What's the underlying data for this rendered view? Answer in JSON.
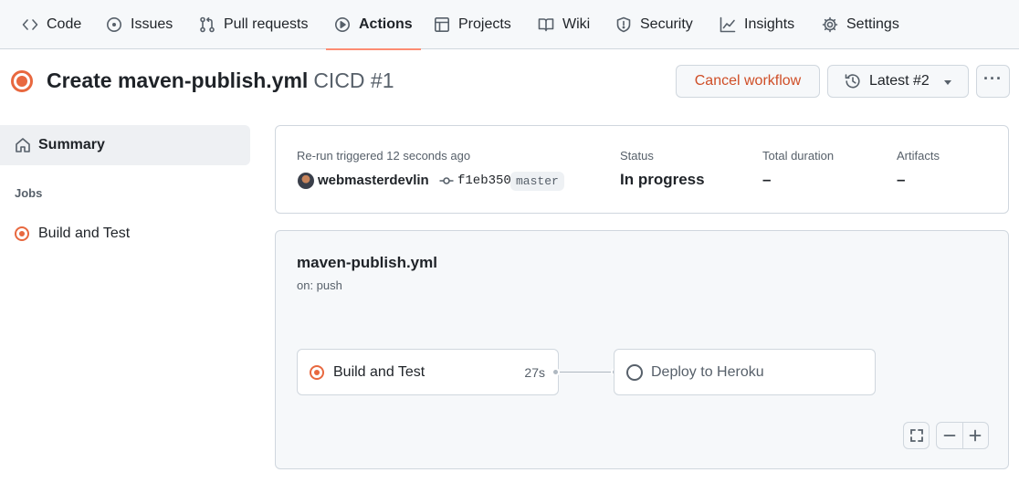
{
  "nav": {
    "items": [
      {
        "label": "Code",
        "icon": "code-icon"
      },
      {
        "label": "Issues",
        "icon": "issue-icon"
      },
      {
        "label": "Pull requests",
        "icon": "pull-request-icon"
      },
      {
        "label": "Actions",
        "icon": "play-icon",
        "active": true
      },
      {
        "label": "Projects",
        "icon": "table-icon"
      },
      {
        "label": "Wiki",
        "icon": "book-icon"
      },
      {
        "label": "Security",
        "icon": "shield-icon"
      },
      {
        "label": "Insights",
        "icon": "graph-icon"
      },
      {
        "label": "Settings",
        "icon": "gear-icon"
      }
    ]
  },
  "header": {
    "title": "Create maven-publish.yml",
    "subtitle": "CICD #1",
    "cancel_label": "Cancel workflow",
    "latest_label": "Latest #2",
    "more_label": "···",
    "status_color": "#e8683f"
  },
  "sidebar": {
    "summary_label": "Summary",
    "jobs_heading": "Jobs",
    "jobs": [
      {
        "label": "Build and Test",
        "status": "in_progress"
      }
    ]
  },
  "run_info": {
    "trigger_text": "Re-run triggered 12 seconds ago",
    "actor": "webmasterdevlin",
    "commit_sha": "f1eb350",
    "branch": "master",
    "status_label": "Status",
    "status_value": "In progress",
    "duration_label": "Total duration",
    "duration_value": "–",
    "artifacts_label": "Artifacts",
    "artifacts_value": "–"
  },
  "workflow": {
    "file_name": "maven-publish.yml",
    "trigger": "on: push",
    "jobs": [
      {
        "name": "Build and Test",
        "duration": "27s",
        "status": "in_progress"
      },
      {
        "name": "Deploy to Heroku",
        "duration": "",
        "status": "pending"
      }
    ],
    "zoom_out_label": "−",
    "zoom_in_label": "+"
  },
  "colors": {
    "accent_orange": "#e8683f",
    "cancel_text": "#cf4e27",
    "nav_underline": "#fd8c73"
  }
}
